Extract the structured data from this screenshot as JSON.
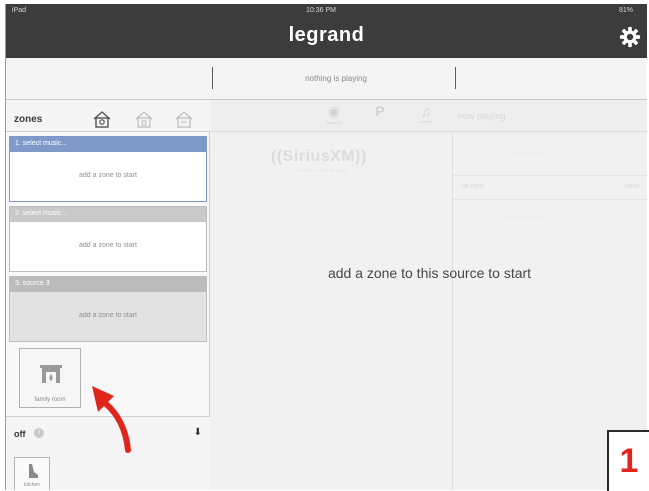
{
  "status_bar": {
    "device": "iPad",
    "time": "10:36 PM",
    "battery": "81%"
  },
  "app": {
    "title": "legrand"
  },
  "now_playing_bar": {
    "text": "nothing is playing"
  },
  "sidebar": {
    "zones_label": "zones",
    "house_icons": [
      "house-active-icon",
      "house-icon",
      "house-icon"
    ],
    "sources": [
      {
        "header": "1. select music...",
        "body": "add a zone to start",
        "state": "selected"
      },
      {
        "header": "2. select music...",
        "body": "add a zone to start",
        "state": "normal"
      },
      {
        "header": "3. source 3",
        "body": "add a zone to start",
        "state": "shaded"
      }
    ],
    "zone_tile": {
      "label": "family room",
      "icon": "fireplace-icon"
    },
    "off_section": {
      "label": "off",
      "zone_tile": {
        "label": "kitchen",
        "icon": "kitchen-icon"
      }
    }
  },
  "main": {
    "tabs": [
      {
        "icon": "sirius-tab-icon",
        "label": "SiriusXM"
      },
      {
        "icon": "pandora-tab-icon",
        "label": "P"
      },
      {
        "icon": "music-note-icon",
        "label": "Library"
      }
    ],
    "now_playing_label": "now playing",
    "up_next_label": "up next",
    "up_next_right": "clear",
    "sirius_logo": "((SiriusXM))",
    "sirius_sub": "SATELLITE RADIO",
    "message": "add a zone to this source to start"
  },
  "annotation": {
    "callout_number": "1",
    "arrow_color": "#e0261c"
  },
  "colors": {
    "header": "#3c3c3c",
    "selected": "#7f9ac9",
    "accent": "#e0261c"
  }
}
